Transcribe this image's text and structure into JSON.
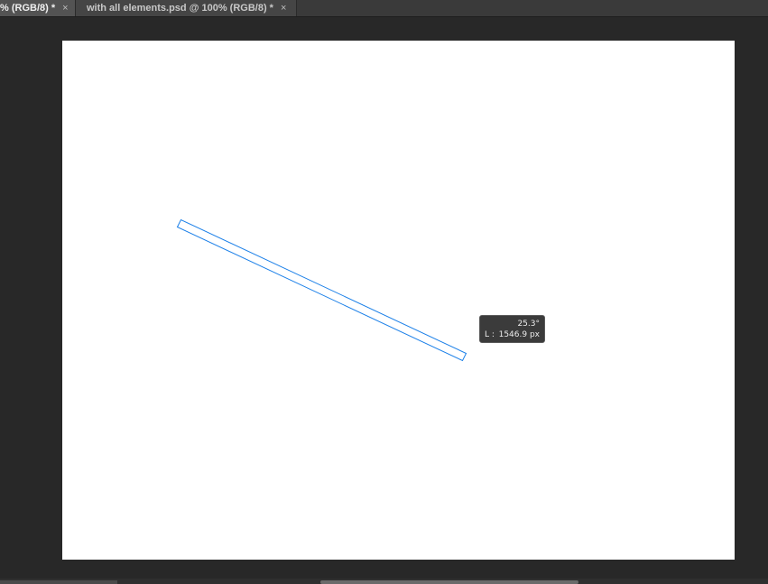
{
  "tabs": [
    {
      "label": "% (RGB/8) *",
      "close": "×",
      "active": true
    },
    {
      "label": "with all elements.psd @ 100% (RGB/8) *",
      "close": "×",
      "active": false
    }
  ],
  "hud": {
    "angle": "25.3°",
    "length_label": "L :",
    "length_value": "1546.9 px"
  },
  "colors": {
    "workspace": "#282828",
    "canvas": "#ffffff",
    "path_stroke": "#1a7fe8",
    "tab_active": "#535353",
    "tab_inactive": "#454545"
  }
}
